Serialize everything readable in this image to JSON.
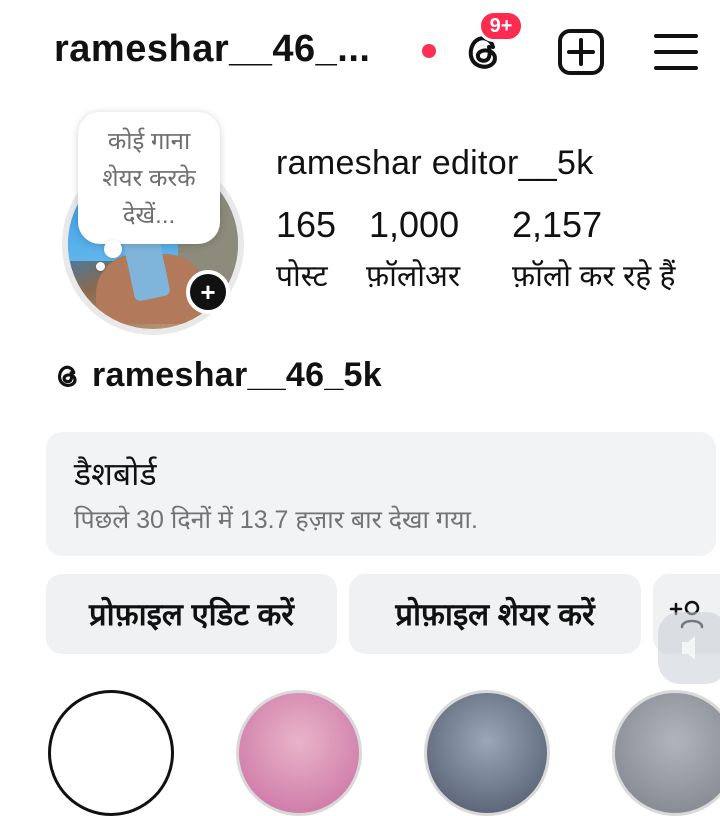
{
  "header": {
    "username": "rameshar__46_...",
    "threads_badge": "9+",
    "accent_color": "#ff2e55"
  },
  "profile": {
    "note": "कोई गाना\nशेयर करके\nदेखें...",
    "add_story_symbol": "+",
    "display_name": "rameshar editor__5k",
    "stats": {
      "posts_count": "165",
      "posts_label": "पोस्ट",
      "followers_count": "1,000",
      "followers_label": "फ़ॉलोअर",
      "following_count": "2,157",
      "following_label": "फ़ॉलो कर रहे हैं"
    },
    "threads_handle": "rameshar__46_5k"
  },
  "dashboard": {
    "title": "डैशबोर्ड",
    "subtitle": "पिछले 30 दिनों में 13.7 हज़ार बार देखा गया."
  },
  "actions": {
    "edit_label": "प्रोफ़ाइल एडिट करें",
    "share_label": "प्रोफ़ाइल शेयर करें"
  },
  "icons": {
    "threads": "threads-icon",
    "create": "create-plus-square-icon",
    "menu": "hamburger-menu-icon",
    "add_user": "add-person-icon",
    "sound": "sound-icon"
  }
}
